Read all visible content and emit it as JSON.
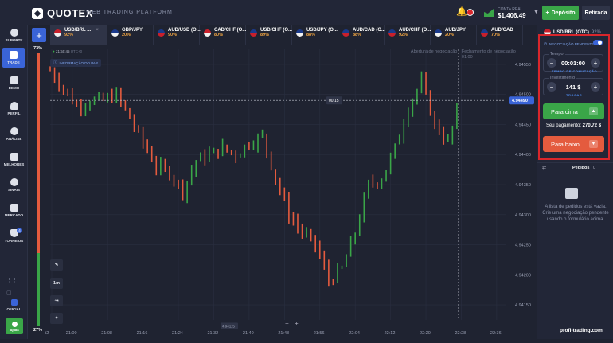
{
  "header": {
    "brand": "QUOTEX",
    "platform": "WEB TRADING PLATFORM",
    "account_type": "CONTA REAL",
    "balance": "$1,406.49",
    "deposit_label": "Depósito",
    "withdraw_label": "Retirada"
  },
  "sidebar": {
    "items": [
      {
        "label": "SUPORTE"
      },
      {
        "label": "TRADE"
      },
      {
        "label": "DEMO"
      },
      {
        "label": "PERFIL"
      },
      {
        "label": "ANÁLISE"
      },
      {
        "label": "MELHORES"
      },
      {
        "label": "SINAIS"
      },
      {
        "label": "MERCADO"
      },
      {
        "label": "TORNEIOS"
      }
    ],
    "official_label": "OFICIAL",
    "help_label": "Ajuda",
    "tournament_badge": "4"
  },
  "tabs": [
    {
      "name": "USD/BRL ...",
      "percent": "92%",
      "colors": [
        "#c9202c",
        "#f2f2f2"
      ]
    },
    {
      "name": "GBP/JPY",
      "percent": "20%",
      "colors": [
        "#1b3a8c",
        "#f2f2f2"
      ]
    },
    {
      "name": "AUD/USD (O...",
      "percent": "90%",
      "colors": [
        "#1b3a8c",
        "#c9202c"
      ]
    },
    {
      "name": "CAD/CHF (O...",
      "percent": "80%",
      "colors": [
        "#c9202c",
        "#f2f2f2"
      ]
    },
    {
      "name": "USD/CHF (O...",
      "percent": "89%",
      "colors": [
        "#1b3a8c",
        "#c9202c"
      ]
    },
    {
      "name": "USD/JPY (O...",
      "percent": "88%",
      "colors": [
        "#1b3a8c",
        "#f2f2f2"
      ]
    },
    {
      "name": "AUD/CAD (O...",
      "percent": "88%",
      "colors": [
        "#1b3a8c",
        "#c9202c"
      ]
    },
    {
      "name": "AUD/CHF (O...",
      "percent": "92%",
      "colors": [
        "#1b3a8c",
        "#c9202c"
      ]
    },
    {
      "name": "AUD/JPY",
      "percent": "20%",
      "colors": [
        "#1b3a8c",
        "#f2f2f2"
      ]
    },
    {
      "name": "AUD/CAD",
      "percent": "70%",
      "colors": [
        "#1b3a8c",
        "#c9202c"
      ]
    }
  ],
  "chart": {
    "info_label": "INFORMAÇÃO DO PAR",
    "server_time": "21:50:45",
    "server_tz": "UTC+0",
    "opening_label": "Abertura de negociação",
    "closing_label": "Fechamento de negociação",
    "closing_time": "01:00",
    "timer": "00:15",
    "current_price": "4.94490",
    "cursor_price": "4.94115",
    "up_pct": "73%",
    "down_pct": "27%",
    "timeframe": "1m",
    "zoom_minus": "−",
    "zoom_plus": "+",
    "y_ticks": [
      "4.94550",
      "4.94500",
      "4.94450",
      "4.94400",
      "4.94350",
      "4.94300",
      "4.94250",
      "4.94200",
      "4.94150"
    ],
    "x_ticks": [
      "i2",
      "21:00",
      "21:08",
      "21:16",
      "21:24",
      "21:32",
      "21:40",
      "21:48",
      "21:56",
      "22:04",
      "22:12",
      "22:20",
      "22:28",
      "22:36"
    ]
  },
  "chart_data": {
    "type": "candlestick",
    "ylim": [
      4.94125,
      4.94575
    ],
    "x_range": [
      "20:55",
      "22:38"
    ],
    "trend": [
      [
        0,
        4.9454
      ],
      [
        3,
        4.9451
      ],
      [
        6,
        4.9448
      ],
      [
        9,
        4.9449
      ],
      [
        12,
        4.9449
      ],
      [
        15,
        4.945
      ],
      [
        18,
        4.9446
      ],
      [
        21,
        4.9442
      ],
      [
        24,
        4.9438
      ],
      [
        27,
        4.9437
      ],
      [
        30,
        4.9434
      ],
      [
        33,
        4.9439
      ],
      [
        36,
        4.944
      ],
      [
        39,
        4.9441
      ],
      [
        42,
        4.944
      ],
      [
        45,
        4.9442
      ],
      [
        48,
        4.9443
      ],
      [
        51,
        4.9436
      ],
      [
        54,
        4.943
      ],
      [
        57,
        4.9427
      ],
      [
        60,
        4.9425
      ],
      [
        63,
        4.9419
      ],
      [
        66,
        4.9421
      ],
      [
        69,
        4.9427
      ],
      [
        72,
        4.9435
      ],
      [
        75,
        4.9436
      ],
      [
        78,
        4.9441
      ],
      [
        81,
        4.9448
      ],
      [
        84,
        4.9452
      ],
      [
        87,
        4.9445
      ],
      [
        90,
        4.9442
      ],
      [
        92,
        4.9447
      ]
    ]
  },
  "trade_panel": {
    "asset_name": "USD/BRL (OTC)",
    "asset_payout": "92%",
    "pending_label": "NEGOCIAÇÃO PENDENTE",
    "time_label": "Tempo",
    "time_value": "00:01:00",
    "time_switch": "TEMPO DE COMUTAÇÃO",
    "investment_label": "Investimento",
    "investment_value": "141 $",
    "investment_switch": "TROCAR",
    "up_label": "Para cima",
    "payout_label": "Seu pagamento:",
    "payout_value": "270.72 $",
    "down_label": "Para baixo",
    "orders_label": "Pedidos",
    "orders_count": "0",
    "empty_text": "A lista de pedidos está vazia. Crie uma negociação pendente usando o formulário acima.",
    "up_color": "#3aa648",
    "down_color": "#e45b3e"
  },
  "watermark": "profi-trading.com"
}
